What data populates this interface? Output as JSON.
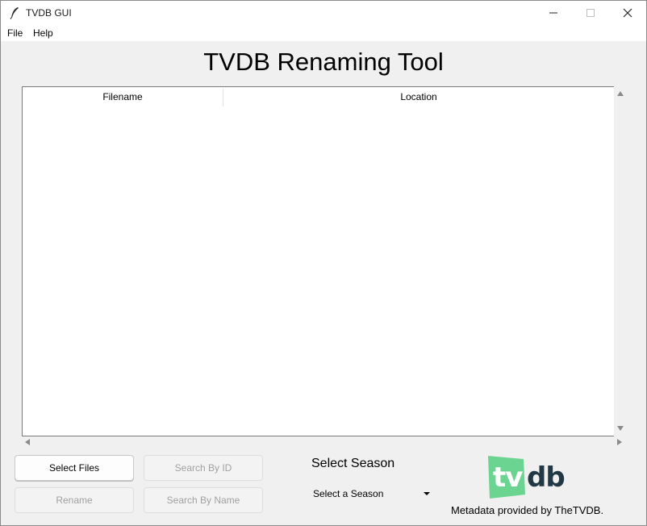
{
  "window": {
    "title": "TVDB GUI",
    "icon": "feather-icon"
  },
  "menubar": {
    "items": [
      {
        "label": "File"
      },
      {
        "label": "Help"
      }
    ]
  },
  "main": {
    "title": "TVDB Renaming Tool"
  },
  "file_table": {
    "columns": [
      "Filename",
      "Location"
    ],
    "rows": []
  },
  "buttons": {
    "select_files": "Select Files",
    "rename": "Rename",
    "search_by_id": "Search By ID",
    "search_by_name": "Search By Name"
  },
  "season": {
    "label": "Select Season",
    "selected": "Select a Season"
  },
  "footer": {
    "logo_text": "tvdb",
    "attribution": "Metadata provided by TheTVDB."
  },
  "colors": {
    "logo_green": "#6cd491",
    "logo_dark": "#223845",
    "window_bg": "#f0f0f0"
  }
}
